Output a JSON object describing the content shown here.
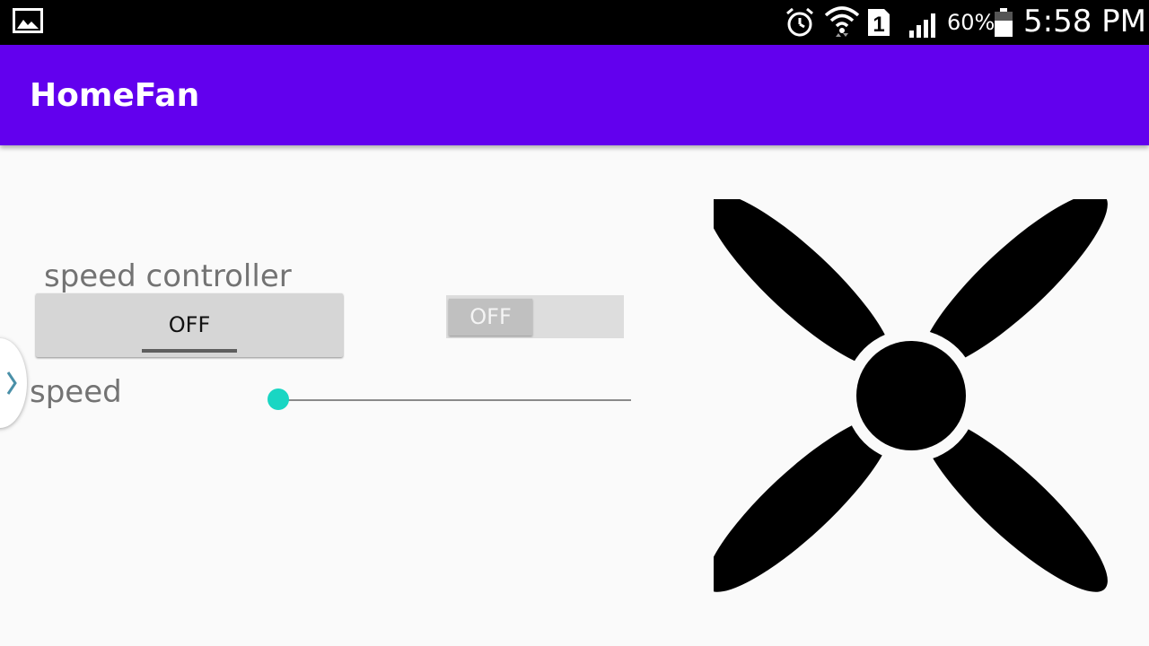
{
  "status_bar": {
    "icons": [
      "gallery-icon",
      "alarm-icon",
      "wifi-icon",
      "sim-1-icon",
      "signal-icon",
      "battery-icon"
    ],
    "sim_slot": "1",
    "battery_percent": "60%",
    "time": "5:58 PM"
  },
  "app_bar": {
    "title": "HomeFan",
    "color": "#6200ee"
  },
  "controls": {
    "speed_controller_label": "speed controller",
    "power_button_label": "OFF",
    "toggle_label": "OFF",
    "speed_label": "speed",
    "speed_value": 0,
    "accent_color": "#19d6c3"
  },
  "drawer_handle": {
    "icon": "chevron-right-icon"
  },
  "fan_image": {
    "icon": "fan-icon"
  }
}
